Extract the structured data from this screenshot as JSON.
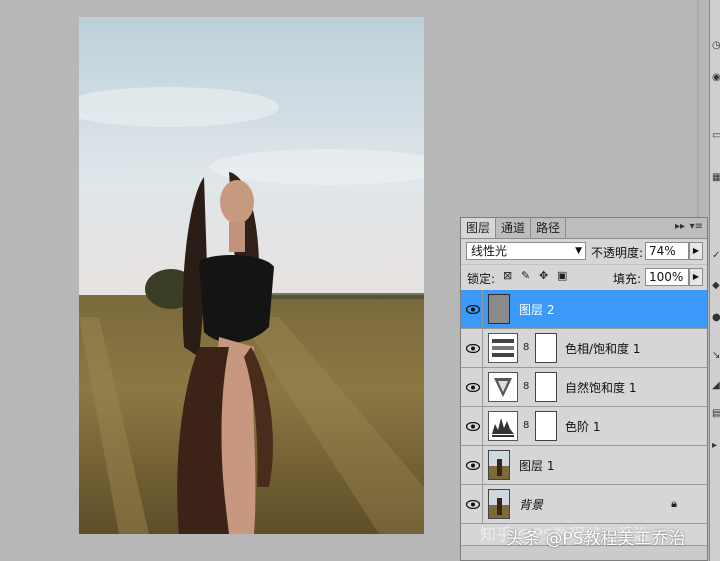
{
  "canvas": {
    "photo": "portrait-photo",
    "subject": "woman-in-field"
  },
  "layers_panel": {
    "tabs": [
      {
        "label": "图层",
        "active": true
      },
      {
        "label": "通道",
        "active": false
      },
      {
        "label": "路径",
        "active": false
      }
    ],
    "collapse_glyph": "▸▸",
    "menu_glyph": "▾≡",
    "blend_mode": "线性光",
    "opacity_label": "不透明度:",
    "opacity_value": "74%",
    "lock_label": "锁定:",
    "fill_label": "填充:",
    "fill_value": "100%",
    "layers": [
      {
        "name": "图层 2",
        "type": "pixel-gray",
        "selected": true
      },
      {
        "name": "色相/饱和度 1",
        "type": "adjustment-hue-saturation",
        "selected": false
      },
      {
        "name": "自然饱和度 1",
        "type": "adjustment-vibrance",
        "selected": false
      },
      {
        "name": "色阶 1",
        "type": "adjustment-levels",
        "selected": false
      },
      {
        "name": "图层 1",
        "type": "photo",
        "selected": false
      },
      {
        "name": "背景",
        "type": "photo-background",
        "selected": false,
        "locked": true
      }
    ]
  },
  "watermark": {
    "text": "头条 @PS教程美工乔治",
    "ghost_text": "知乎 @PS数程美工乔治"
  },
  "colors": {
    "selection": "#3b99fc",
    "panel_bg": "#d6d6d6",
    "workspace": "#b7b7b7"
  },
  "icons": [
    "eye-icon",
    "chain-link-icon",
    "lock-icon",
    "brush-icon",
    "move-icon",
    "checker-icon",
    "dropdown-arrow-icon"
  ]
}
